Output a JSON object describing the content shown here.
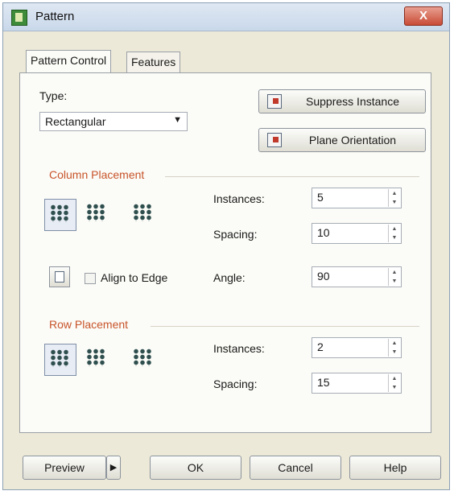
{
  "window": {
    "title": "Pattern",
    "close_label": "X"
  },
  "tabs": [
    {
      "label": "Pattern Control",
      "active": true
    },
    {
      "label": "Features",
      "active": false
    }
  ],
  "type": {
    "label": "Type:",
    "value": "Rectangular"
  },
  "buttons": {
    "suppress_instance": "Suppress Instance",
    "plane_orientation": "Plane Orientation"
  },
  "column_placement": {
    "title": "Column Placement",
    "instances_label": "Instances:",
    "instances_value": "5",
    "spacing_label": "Spacing:",
    "spacing_value": "10",
    "angle_label": "Angle:",
    "angle_value": "90",
    "align_label": "Align to Edge",
    "align_checked": false
  },
  "row_placement": {
    "title": "Row Placement",
    "instances_label": "Instances:",
    "instances_value": "2",
    "spacing_label": "Spacing:",
    "spacing_value": "15"
  },
  "footer": {
    "preview": "Preview",
    "ok": "OK",
    "cancel": "Cancel",
    "help": "Help"
  },
  "icons": {
    "app": "pattern-app-icon",
    "spin": "spinner-arrows-icon",
    "grid": "grid-dots-icon"
  },
  "colors": {
    "group_title": "#c8542a",
    "dialog_bg": "#ece9d8"
  }
}
